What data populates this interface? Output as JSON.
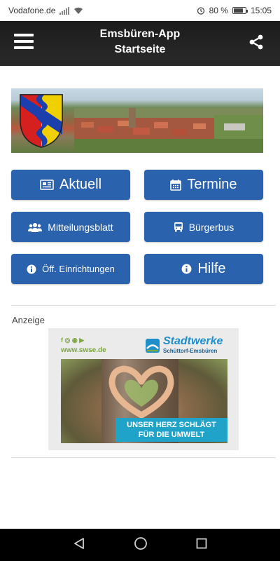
{
  "status_bar": {
    "carrier": "Vodafone.de",
    "battery_percent": "80 %",
    "battery_level": 0.8,
    "time": "15:05"
  },
  "app_bar": {
    "title": "Emsbüren-App",
    "subtitle": "Startseite"
  },
  "buttons": {
    "aktuell": "Aktuell",
    "termine": "Termine",
    "mitteilungsblatt": "Mitteilungsblatt",
    "buergerbus": "Bürgerbus",
    "einrichtungen": "Öff. Einrichtungen",
    "hilfe": "Hilfe"
  },
  "ad": {
    "label": "Anzeige",
    "social": "f ◎ ◉ ▶",
    "url": "www.swse.de",
    "brand": "Stadtwerke",
    "brand_sub": "Schüttorf-Emsbüren",
    "slogan_line1": "UNSER HERZ SCHLÄGT",
    "slogan_line2": "FÜR DIE UMWELT"
  },
  "colors": {
    "button": "#2a62ad",
    "app_bar": "#1c1c1c",
    "ad_accent": "#1fa3c9"
  }
}
